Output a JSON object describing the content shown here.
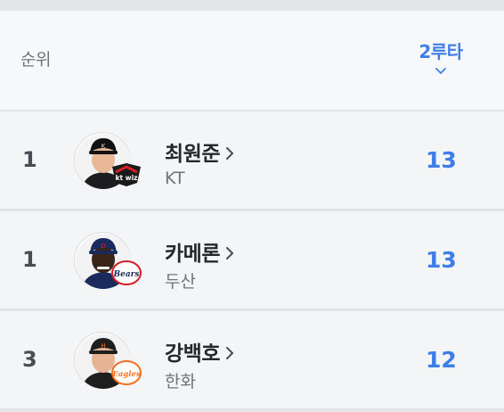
{
  "header": {
    "rank_label": "순위",
    "sort_label": "2루타",
    "sort_icon": "chevron-down-icon"
  },
  "rows": [
    {
      "rank": "1",
      "name": "최원준",
      "team": "KT",
      "value": "13",
      "logo_color": "#1a1a1a",
      "accent": "#d61f26"
    },
    {
      "rank": "1",
      "name": "카메론",
      "team": "두산",
      "value": "13",
      "logo_color": "#1b2a5c",
      "accent": "#d61f26"
    },
    {
      "rank": "3",
      "name": "강백호",
      "team": "한화",
      "value": "12",
      "logo_color": "#1e1e1e",
      "accent": "#f37021"
    }
  ],
  "colors": {
    "accent_blue": "#3d7ee8"
  }
}
